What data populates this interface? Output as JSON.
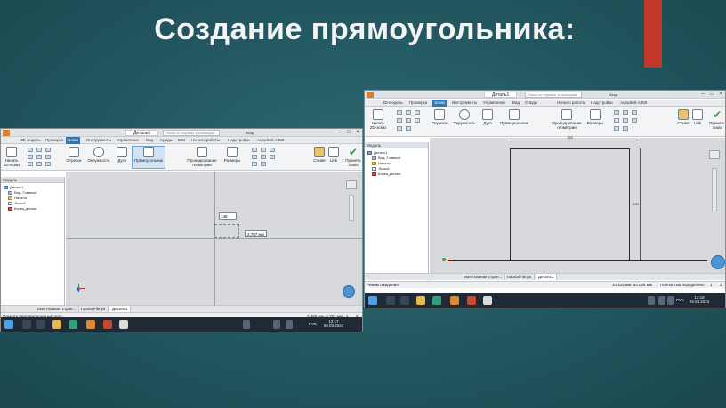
{
  "slide": {
    "title": "Создание прямоугольника:",
    "accent_color": "#c0392b",
    "background_color": "#245a63"
  },
  "shot1": {
    "window": {
      "document_tab": "Деталь1",
      "search_placeholder": "Поиск по справке и командам",
      "user": "Вход"
    },
    "tabs": [
      "3D-модель",
      "Проверка",
      "Эскиз",
      "Инструменты",
      "Управление",
      "Вид",
      "Среды",
      "BIM",
      "Начало работы",
      "Надстройки",
      "Autodesk A360"
    ],
    "active_tab": "Эскиз",
    "ribbon": {
      "start_2d_sketch": "Начать 2D-эскиз",
      "line": "Отрезок",
      "circle": "Окружность",
      "arc": "Дуга",
      "rectangle": "Прямоугольник",
      "project_geometry": "Проецирование геометрии",
      "dimension": "Размеры",
      "create": "Create",
      "link": "Link",
      "finish_sketch": "Принять эскиз"
    },
    "browser": {
      "header": "Модель",
      "items": [
        "Деталь1",
        "Вид: Главный",
        "Начало",
        "Эскиз1",
        "Конец детали"
      ]
    },
    "canvas": {
      "input_value": "148",
      "tooltip": "2,787 мм"
    },
    "doc_tabs": [
      "Моя главная стран...",
      "TutorialFile.ipt",
      "Деталь1"
    ],
    "status": {
      "prompt": "Укажите противоположный угол",
      "coords": "7,385 мм, 2,787 мм",
      "num1": "1",
      "num2": "2"
    },
    "clock": {
      "time": "12:17",
      "date": "09.03.2023",
      "lang": "РУС"
    }
  },
  "shot2": {
    "window": {
      "document_tab": "Деталь1",
      "search_placeholder": "Поиск по справке и командам",
      "user": "Вход"
    },
    "tabs": [
      "3D-модель",
      "Проверка",
      "Эскиз",
      "Инструменты",
      "Управление",
      "Вид",
      "Среды",
      "Начало работы",
      "Надстройки",
      "Autodesk A360"
    ],
    "active_tab": "Эскиз",
    "ribbon": {
      "start_2d_sketch": "Начать 2D-эскиз",
      "line": "Отрезок",
      "circle": "Окружность",
      "arc": "Дуга",
      "rectangle": "Прямоугольник",
      "project_geometry": "Проецирование геометрии",
      "dimension": "Размеры",
      "create": "Create",
      "link": "Link",
      "finish_sketch": "Принять эскиз"
    },
    "browser": {
      "header": "Модель",
      "items": [
        "Деталь1",
        "Вид: Главный",
        "Начало",
        "Эскиз1",
        "Конец детали"
      ]
    },
    "canvas": {
      "dim_horizontal": "133",
      "dim_vertical": "130"
    },
    "doc_tabs": [
      "Моя главная стран...",
      "TutorialFile.ipt",
      "Деталь1"
    ],
    "status": {
      "prompt": "Режим ожидания",
      "coords": "34,425 мм, 54,048 мм",
      "constraint": "Полностью определено",
      "num1": "1",
      "num2": "2"
    },
    "clock": {
      "time": "12:18",
      "date": "09.03.2023",
      "lang": "РУС"
    }
  },
  "icons": {
    "taskbar": [
      "windows-start-icon",
      "search-icon",
      "task-view-icon",
      "file-explorer-icon",
      "edge-icon",
      "inventor-icon",
      "powerpoint-icon",
      "chrome-icon"
    ],
    "tray": [
      "wifi-icon",
      "volume-icon",
      "battery-icon"
    ]
  }
}
